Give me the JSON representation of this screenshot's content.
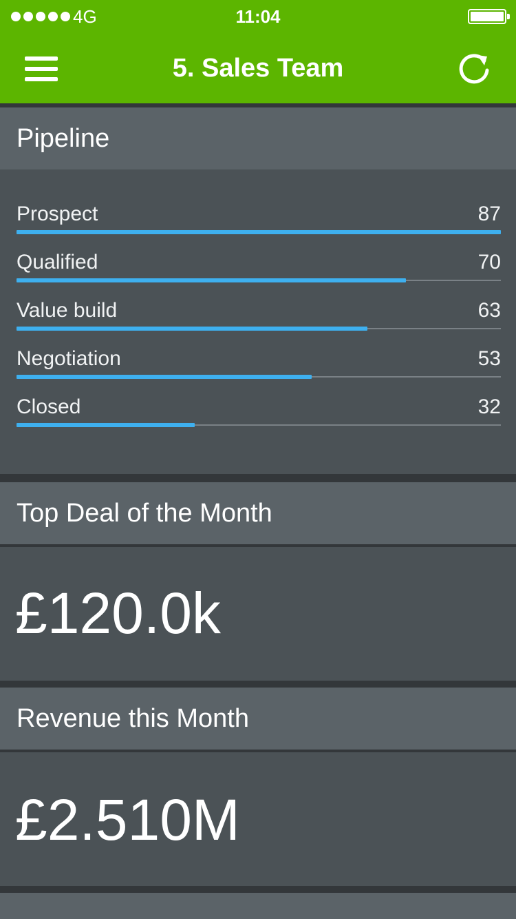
{
  "status_bar": {
    "carrier": "4G",
    "time": "11:04",
    "signal_bars": 5
  },
  "nav": {
    "title": "5. Sales Team",
    "menu_icon": "hamburger-menu-icon",
    "refresh_icon": "refresh-icon"
  },
  "pipeline": {
    "title": "Pipeline",
    "max_value": 87,
    "stages": [
      {
        "label": "Prospect",
        "value": 87
      },
      {
        "label": "Qualified",
        "value": 70
      },
      {
        "label": "Value build",
        "value": 63
      },
      {
        "label": "Negotiation",
        "value": 53
      },
      {
        "label": "Closed",
        "value": 32
      }
    ]
  },
  "top_deal": {
    "title": "Top Deal of the Month",
    "value": "£120.0k"
  },
  "revenue": {
    "title": "Revenue this Month",
    "value": "£2.510M"
  },
  "colors": {
    "brand_green": "#5cb500",
    "bar_blue": "#3eb0ef",
    "card_header": "#5b6368",
    "card_body": "#4b5256"
  }
}
